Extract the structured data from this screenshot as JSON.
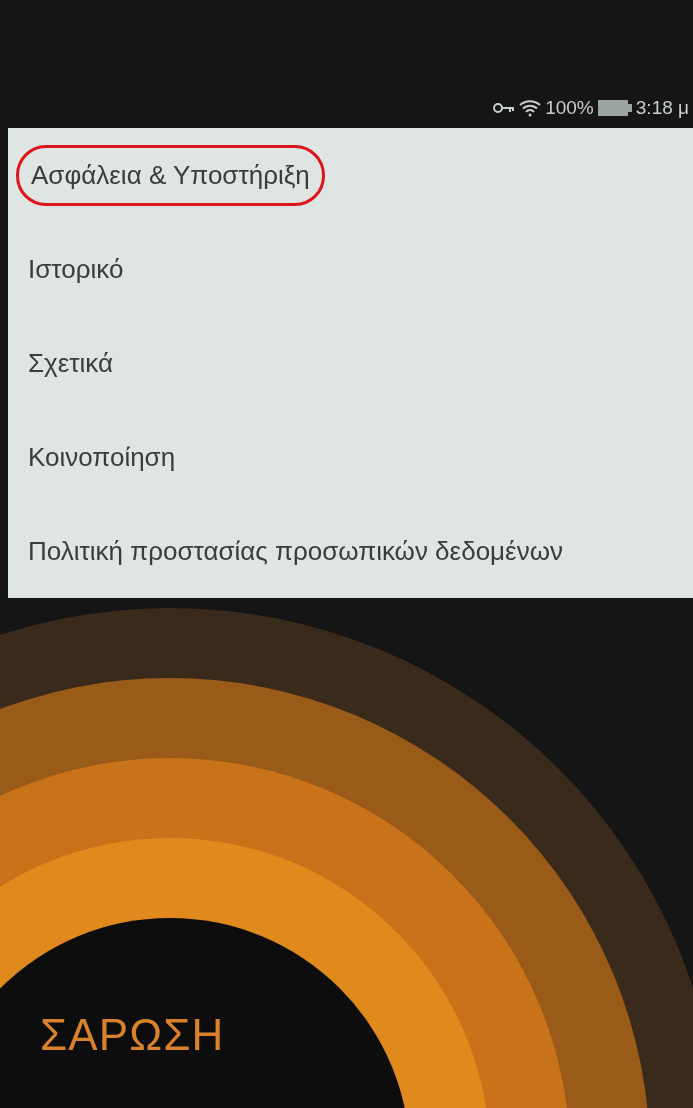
{
  "status_bar": {
    "battery": "100%",
    "time": "3:18 μ"
  },
  "menu": {
    "items": [
      {
        "label": "Ασφάλεια & Υποστήριξη",
        "circled": true
      },
      {
        "label": "Ιστορικό",
        "circled": false
      },
      {
        "label": "Σχετικά",
        "circled": false
      },
      {
        "label": "Κοινοποίηση",
        "circled": false
      },
      {
        "label": "Πολιτική προστασίας προσωπικών δεδομένων",
        "circled": false
      }
    ]
  },
  "scan_button": {
    "label": "ΣΑΡΩΣΗ"
  }
}
